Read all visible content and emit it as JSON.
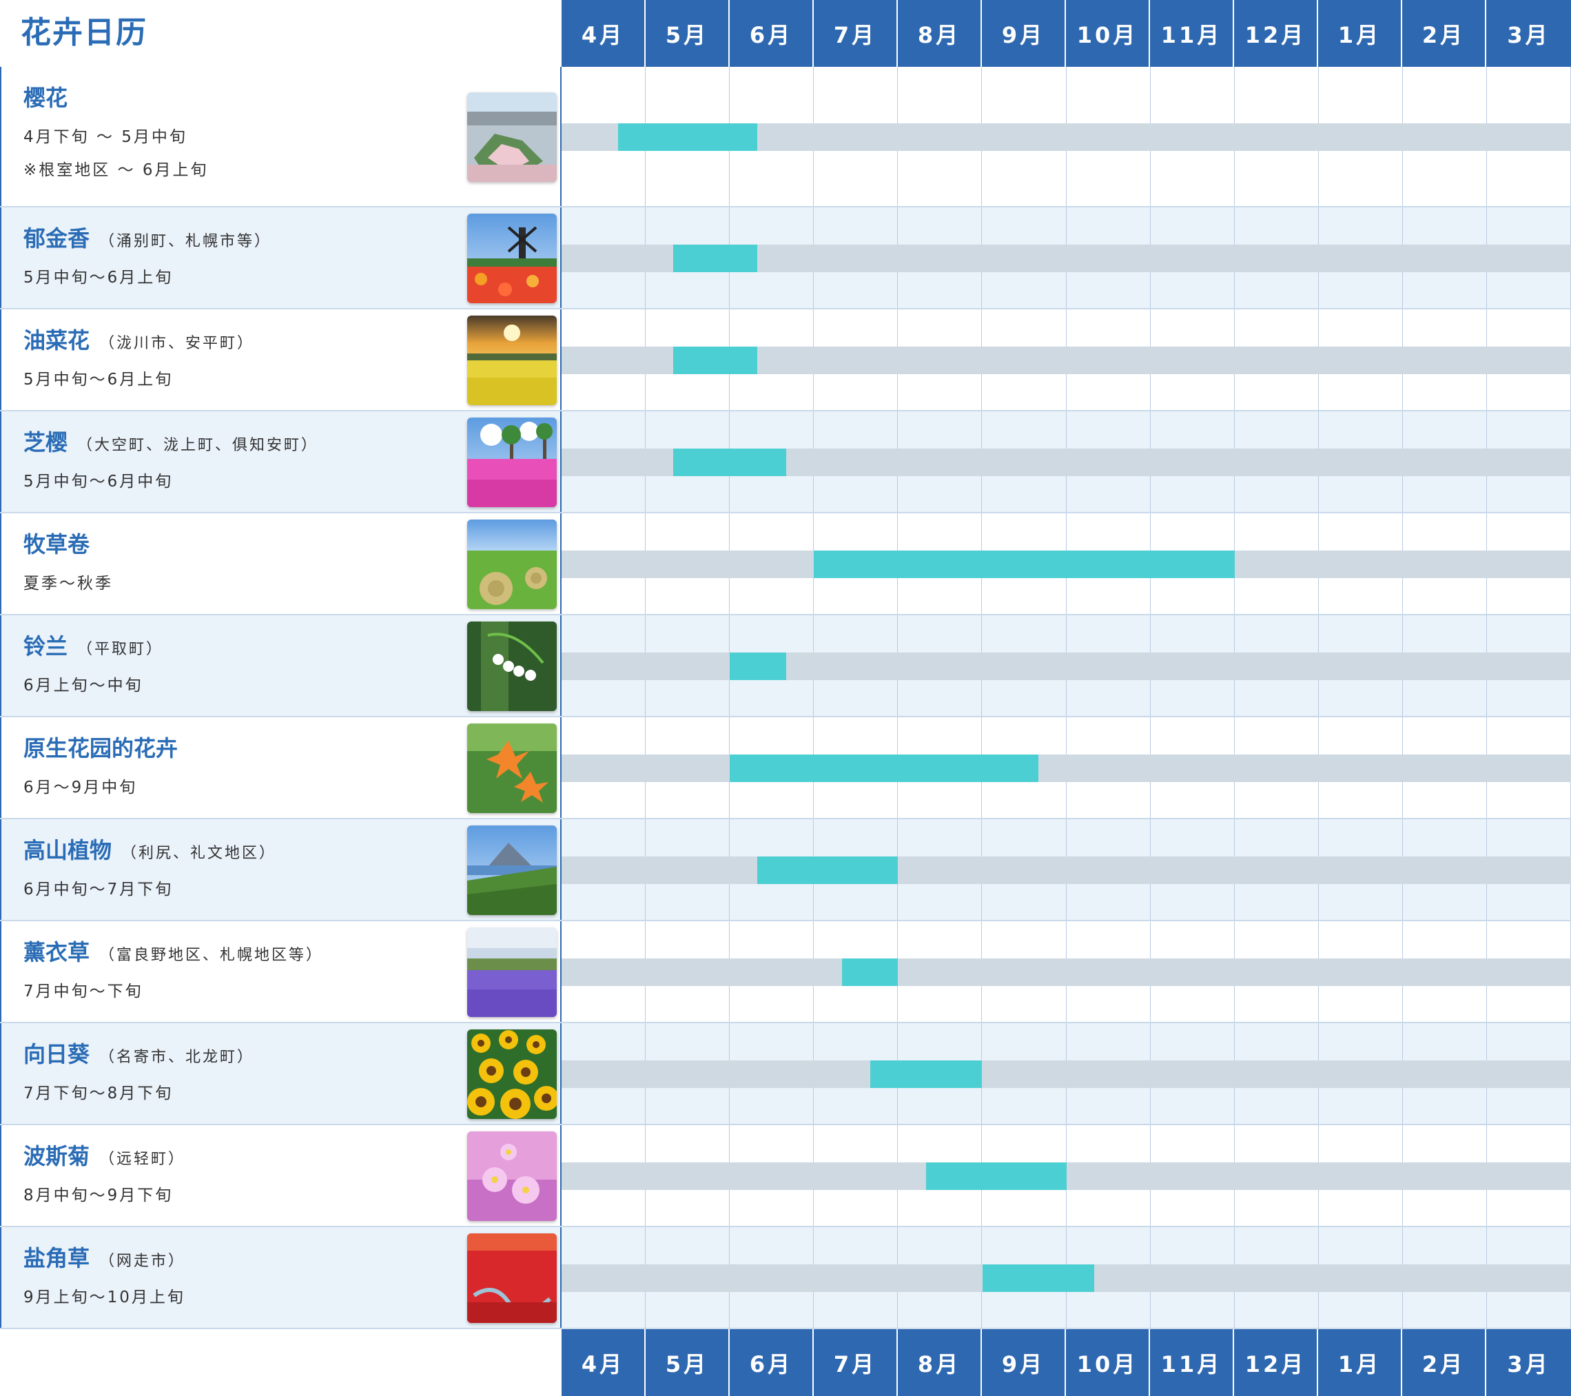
{
  "title": "花卉日历",
  "months": [
    "4月",
    "5月",
    "6月",
    "7月",
    "8月",
    "9月",
    "10月",
    "11月",
    "12月",
    "1月",
    "2月",
    "3月"
  ],
  "colors": {
    "accent": "#2e68b0",
    "title_text": "#2a6cb5",
    "period_bar": "#4ccfd2",
    "track": "#ced9e2",
    "alt_row": "#eaf2fa"
  },
  "flowers": [
    {
      "name": "樱花",
      "location": "",
      "dates": [
        "4月下旬 ～ 5月中旬",
        "※根室地区 ～ 6月上旬"
      ],
      "period": [
        0.67,
        2.33
      ],
      "photo": "fortress-landscape-photo",
      "row_bg": "#ffffff"
    },
    {
      "name": "郁金香",
      "location": "（涌别町、札幌市等）",
      "dates": [
        "5月中旬～6月上旬"
      ],
      "period": [
        1.33,
        2.33
      ],
      "photo": "tulip-windmill-photo",
      "row_bg": "#eaf2fa"
    },
    {
      "name": "油菜花",
      "location": "（泷川市、安平町）",
      "dates": [
        "5月中旬～6月上旬"
      ],
      "period": [
        1.33,
        2.33
      ],
      "photo": "rapeseed-sunset-photo",
      "row_bg": "#ffffff"
    },
    {
      "name": "芝樱",
      "location": "（大空町、泷上町、俱知安町）",
      "dates": [
        "5月中旬～6月中旬"
      ],
      "period": [
        1.33,
        2.67
      ],
      "photo": "moss-phlox-photo",
      "row_bg": "#eaf2fa"
    },
    {
      "name": "牧草卷",
      "location": "",
      "dates": [
        "夏季～秋季"
      ],
      "period": [
        3.0,
        8.0
      ],
      "photo": "hay-bale-photo",
      "row_bg": "#ffffff"
    },
    {
      "name": "铃兰",
      "location": "（平取町）",
      "dates": [
        "6月上旬～中旬"
      ],
      "period": [
        2.0,
        2.67
      ],
      "photo": "lily-of-the-valley-photo",
      "row_bg": "#eaf2fa"
    },
    {
      "name": "原生花园的花卉",
      "location": "",
      "dates": [
        "6月～9月中旬"
      ],
      "period": [
        2.0,
        5.67
      ],
      "photo": "wild-lily-photo",
      "row_bg": "#ffffff"
    },
    {
      "name": "高山植物",
      "location": "（利尻、礼文地区）",
      "dates": [
        "6月中旬～7月下旬"
      ],
      "period": [
        2.33,
        4.0
      ],
      "photo": "alpine-mountain-photo",
      "row_bg": "#eaf2fa"
    },
    {
      "name": "薰衣草",
      "location": "（富良野地区、札幌地区等）",
      "dates": [
        "7月中旬～下旬"
      ],
      "period": [
        3.33,
        4.0
      ],
      "photo": "lavender-field-photo",
      "row_bg": "#ffffff"
    },
    {
      "name": "向日葵",
      "location": "（名寄市、北龙町）",
      "dates": [
        "7月下旬～8月下旬"
      ],
      "period": [
        3.67,
        5.0
      ],
      "photo": "sunflower-field-photo",
      "row_bg": "#eaf2fa"
    },
    {
      "name": "波斯菊",
      "location": "（远轻町）",
      "dates": [
        "8月中旬～9月下旬"
      ],
      "period": [
        4.33,
        6.0
      ],
      "photo": "cosmos-flower-photo",
      "row_bg": "#ffffff"
    },
    {
      "name": "盐角草",
      "location": "（网走市）",
      "dates": [
        "9月上旬～10月上旬"
      ],
      "period": [
        5.0,
        6.33
      ],
      "photo": "glasswort-red-field-photo",
      "row_bg": "#eaf2fa"
    }
  ]
}
